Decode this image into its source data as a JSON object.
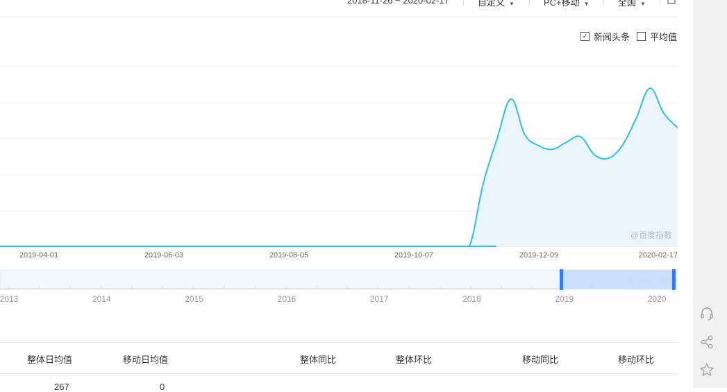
{
  "toolbar": {
    "date_range": "2018-11-26 ~ 2020-02-17",
    "custom_label": "自定义",
    "device_label": "PC+移动",
    "region_label": "全国"
  },
  "legend": {
    "items": [
      {
        "label": "新闻头条",
        "checked": true
      },
      {
        "label": "平均值",
        "checked": false
      }
    ]
  },
  "watermark": "@百度指数",
  "chart_data": {
    "type": "area",
    "x_ticks": [
      "2019-04-01",
      "2019-06-03",
      "2019-08-05",
      "2019-10-07",
      "2019-12-09",
      "2020-02-17"
    ],
    "series": [
      {
        "color": "#2ac0e6",
        "x": [
          "2019-10-28",
          "2019-11-04",
          "2019-11-11",
          "2019-11-18",
          "2019-11-25",
          "2019-12-02",
          "2019-12-09",
          "2019-12-16",
          "2019-12-23",
          "2019-12-30",
          "2020-01-06",
          "2020-01-13",
          "2020-01-20",
          "2020-01-27",
          "2020-02-03",
          "2020-02-10",
          "2020-02-17"
        ],
        "y": [
          0,
          0,
          0.35,
          0.6,
          0.82,
          0.62,
          0.56,
          0.54,
          0.58,
          0.61,
          0.51,
          0.49,
          0.56,
          0.71,
          0.88,
          0.74,
          0.66
        ]
      }
    ],
    "y_values_note_hidden": true,
    "navigator": {
      "years": [
        "2013",
        "2014",
        "2015",
        "2016",
        "2017",
        "2018",
        "2019",
        "2020"
      ],
      "selected_range": [
        "2018-11-26",
        "2020-02-17"
      ]
    }
  },
  "table": {
    "headers": [
      "整体日均值",
      "移动日均值",
      "整体同比",
      "整体环比",
      "移动同比",
      "移动环比"
    ],
    "row_partial": [
      "267",
      "0"
    ]
  },
  "colors": {
    "line": "#2ac0e6",
    "fill": "#eaf6fb",
    "nav_fill": "#f2f7fc",
    "nav_selected": "#c6dafc",
    "handle": "#2f7cff"
  },
  "icons": [
    "headset-icon",
    "share-icon",
    "star-icon",
    "export-icon"
  ]
}
